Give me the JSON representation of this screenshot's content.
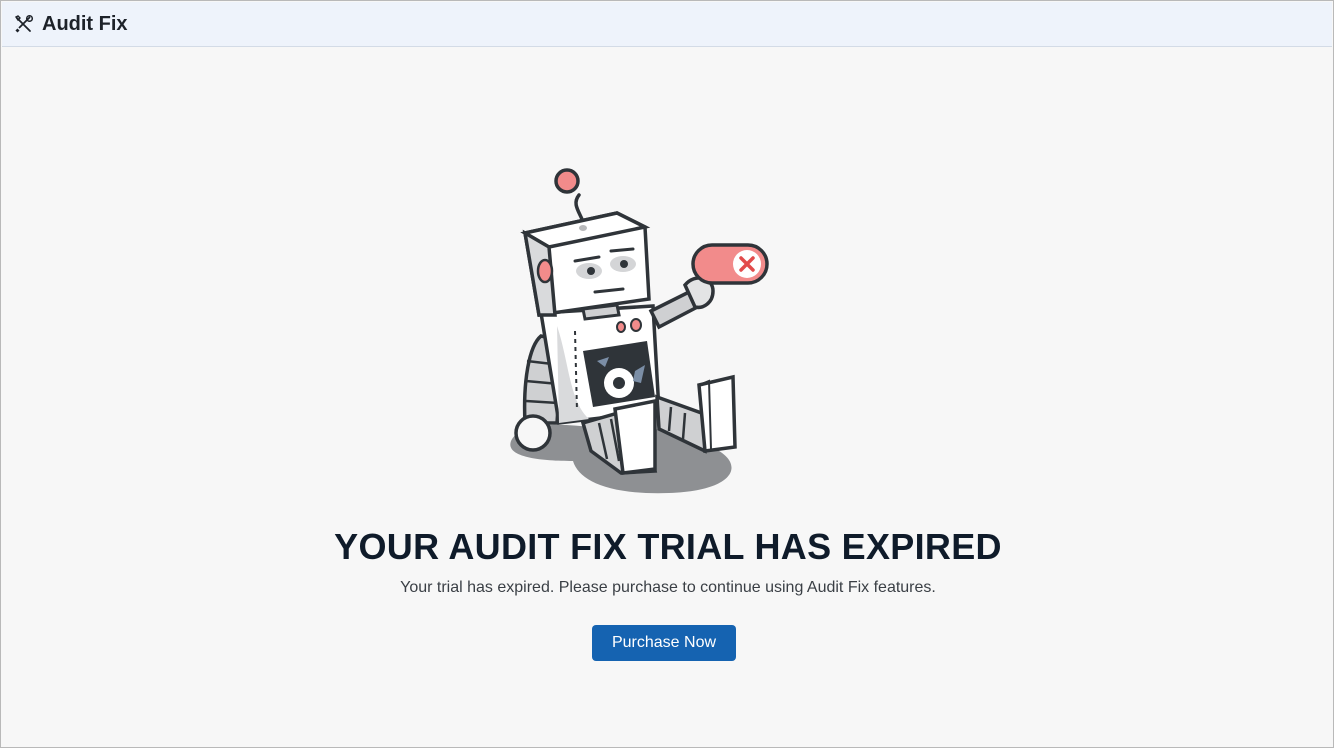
{
  "app": {
    "title": "Audit Fix",
    "icon": "tools-icon"
  },
  "main": {
    "illustration": "sad-robot-illustration",
    "heading": "YOUR AUDIT FIX TRIAL HAS EXPIRED",
    "message": "Your trial has expired. Please purchase to continue using Audit Fix features.",
    "purchase_label": "Purchase Now"
  },
  "colors": {
    "accent": "#1563b1",
    "titlebar_bg": "#eef3fb",
    "toggle_red": "#f28b8b",
    "heading": "#0f1b2a"
  }
}
